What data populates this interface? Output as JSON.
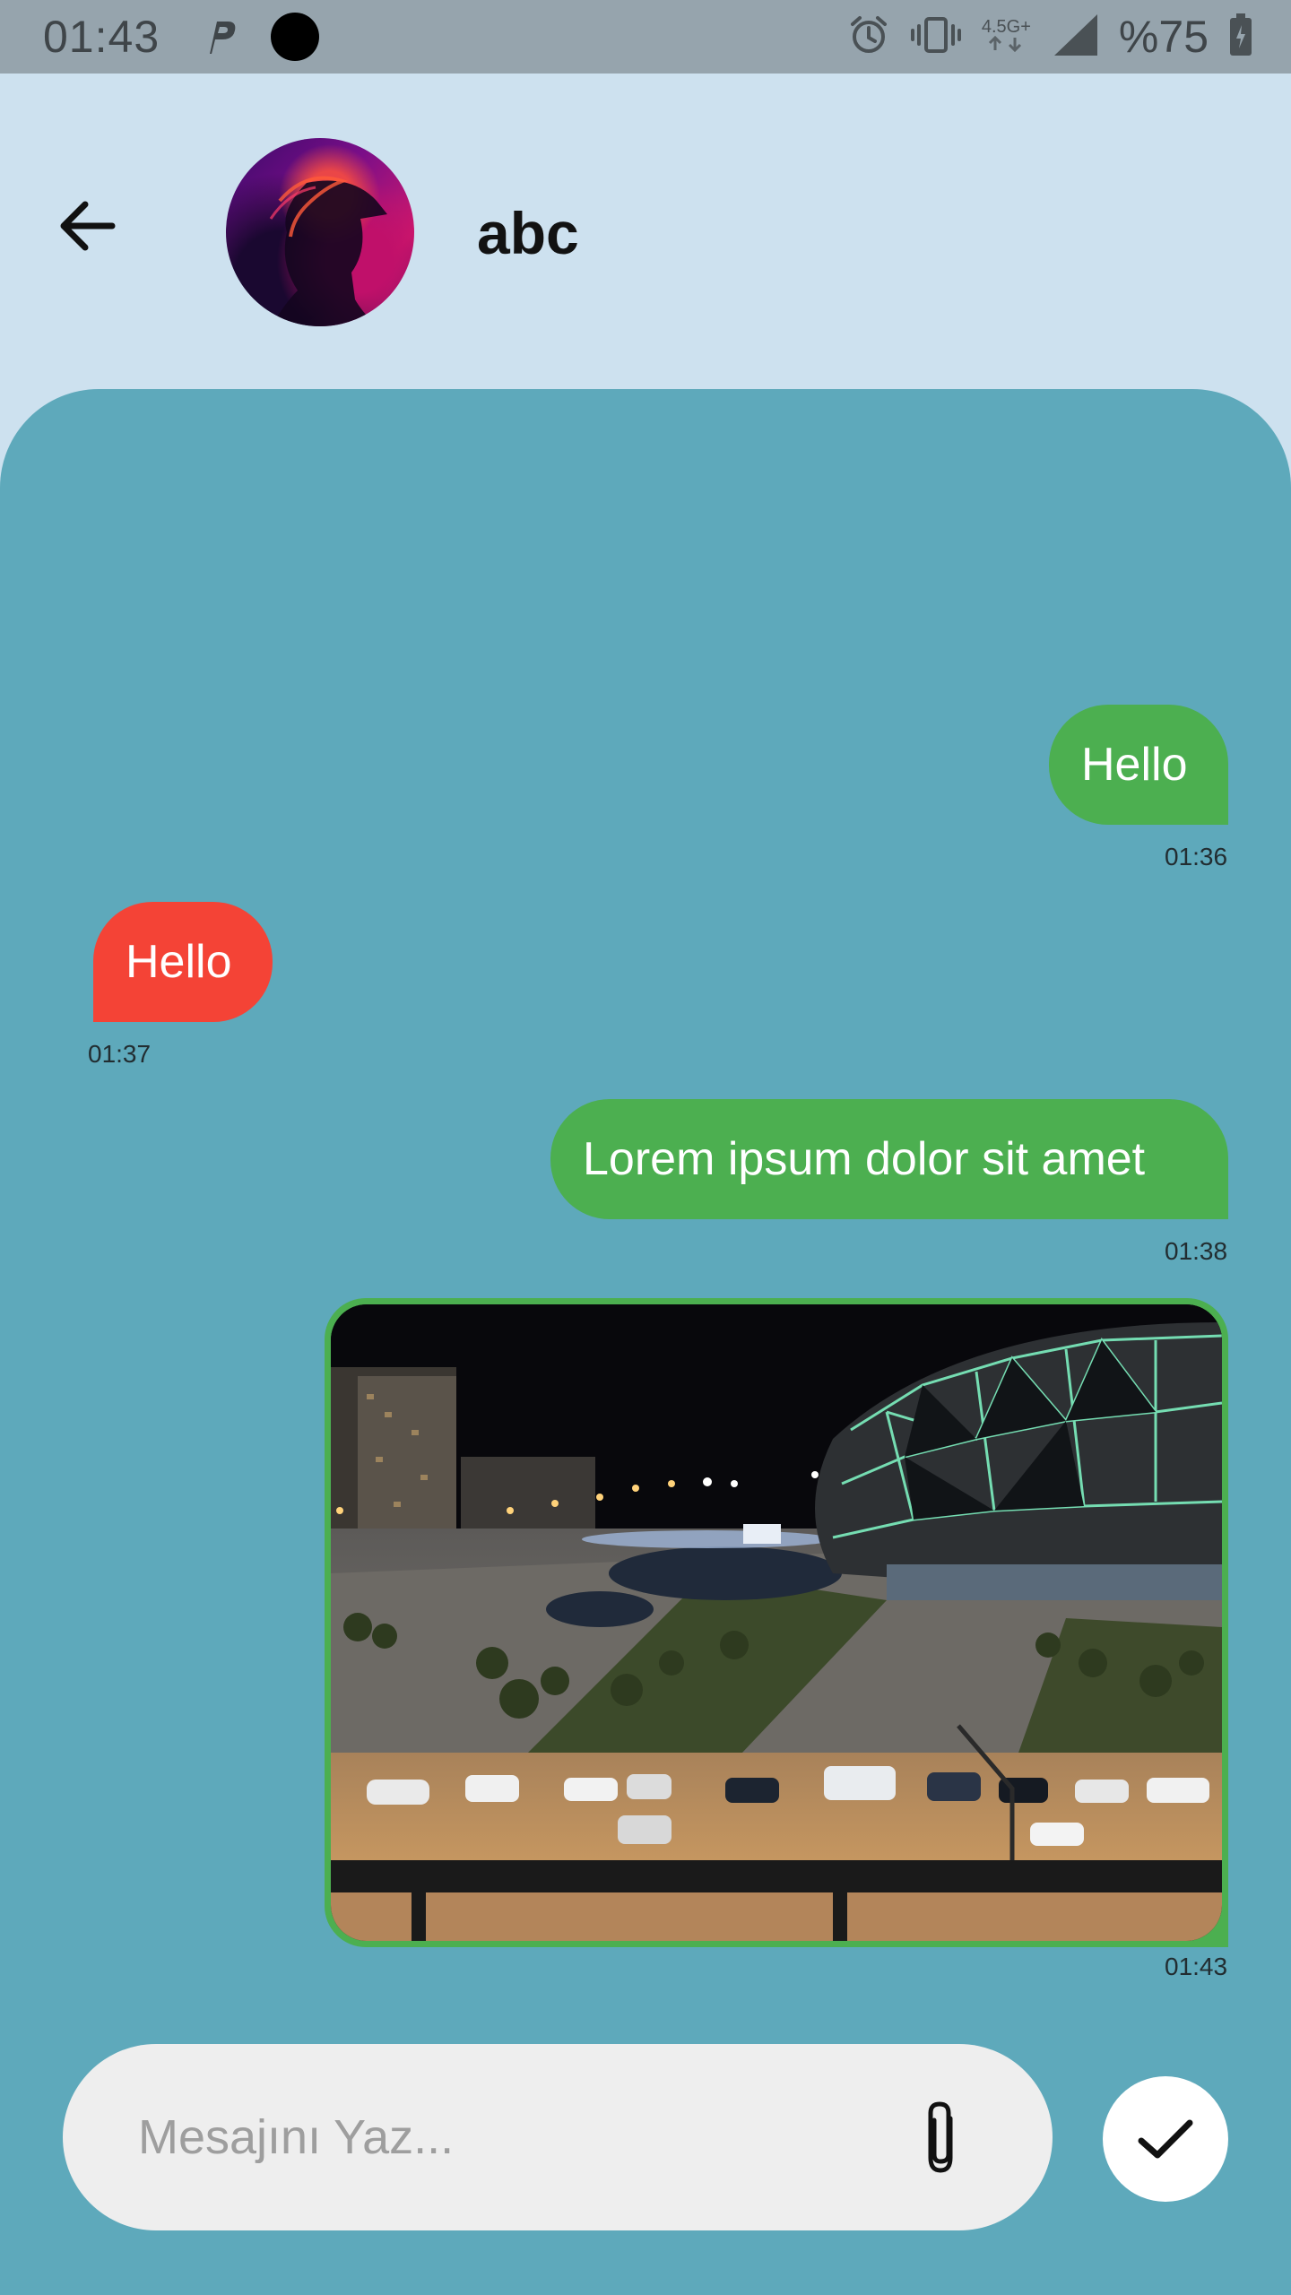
{
  "status_bar": {
    "time": "01:43",
    "network_type": "4.5G+",
    "battery": "%75",
    "icons": [
      "parking-notification-icon",
      "camera-cutout",
      "alarm-icon",
      "vibrate-icon",
      "network-arrows-icon",
      "signal-icon",
      "battery-icon"
    ]
  },
  "header": {
    "back_icon": "arrow-left-icon",
    "contact_name": "abc"
  },
  "messages": [
    {
      "direction": "outgoing",
      "text": "Hello",
      "time": "01:36",
      "color": "#4caf50"
    },
    {
      "direction": "incoming",
      "text": "Hello",
      "time": "01:37",
      "color": "#f44336"
    },
    {
      "direction": "outgoing",
      "text": "Lorem ipsum dolor sit amet",
      "time": "01:38",
      "color": "#4caf50"
    },
    {
      "direction": "outgoing",
      "type": "image",
      "time": "01:43",
      "color": "#4caf50"
    }
  ],
  "composer": {
    "placeholder": "Mesajını Yaz...",
    "value": "",
    "attach_icon": "paperclip-icon",
    "send_icon": "checkmark-icon"
  },
  "colors": {
    "header_bg": "#cde1ef",
    "chat_bg": "#5ea9bb",
    "status_bar_bg": "#96a4ad",
    "outgoing_bubble": "#4caf50",
    "incoming_bubble": "#f44336",
    "input_bg": "#eeeeee"
  }
}
